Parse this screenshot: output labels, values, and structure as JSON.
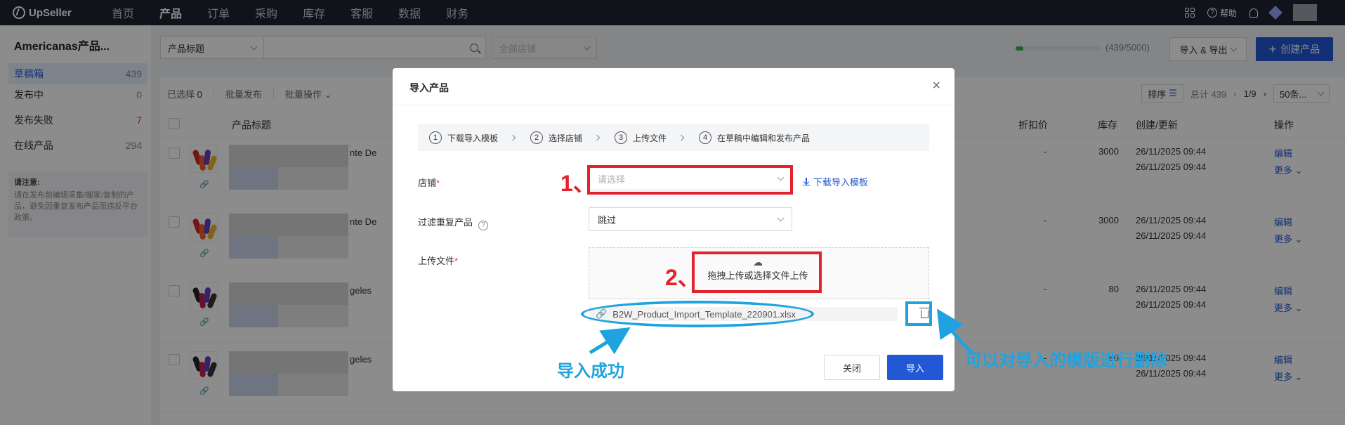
{
  "topnav": {
    "logo": "UpSeller",
    "items": [
      "首页",
      "产品",
      "订单",
      "采购",
      "库存",
      "客服",
      "数据",
      "财务"
    ],
    "active_index": 1,
    "help": "帮助"
  },
  "sidebar": {
    "store_title": "Americanas产品...",
    "items": [
      {
        "label": "草稿箱",
        "count": "439"
      },
      {
        "label": "发布中",
        "count": "0"
      },
      {
        "label": "发布失败",
        "count": "7"
      },
      {
        "label": "在线产品",
        "count": "294"
      }
    ],
    "notice_title": "请注意:",
    "notice_text": "请在发布前编辑采集/搬家/复制的产品，避免因重复发布产品而违反平台政策。"
  },
  "filter": {
    "field": "产品标题",
    "store_placeholder": "全部店铺"
  },
  "quota": {
    "text": "(439/5000)",
    "fraction": 0.088
  },
  "actions": {
    "import_export": "导入 & 导出",
    "create": "创建产品"
  },
  "toolbar": {
    "selected_label": "已选择",
    "selected_count": "0",
    "batch_publish": "批量发布",
    "batch_ops": "批量操作",
    "sort": "排序",
    "total": "总计 439",
    "page": "1/9",
    "per_page": "50条..."
  },
  "table": {
    "headers": {
      "title": "产品标题",
      "discount": "折扣价",
      "stock": "库存",
      "created": "创建/更新",
      "actions": "操作"
    },
    "rows": [
      {
        "title_suffix": "nte De",
        "discount": "-",
        "stock": "3000",
        "created": "26/11/2025 09:44",
        "updated": "26/11/2025 09:44",
        "edit": "编辑",
        "more": "更多"
      },
      {
        "title_suffix": "nte De",
        "discount": "-",
        "stock": "3000",
        "created": "26/11/2025 09:44",
        "updated": "26/11/2025 09:44",
        "edit": "编辑",
        "more": "更多"
      },
      {
        "title_suffix": "geles",
        "discount": "-",
        "stock": "80",
        "created": "26/11/2025 09:44",
        "updated": "26/11/2025 09:44",
        "edit": "编辑",
        "more": "更多"
      },
      {
        "title_suffix": "geles",
        "discount": "-",
        "stock": "80",
        "created": "26/11/2025 09:44",
        "updated": "26/11/2025 09:44",
        "edit": "编辑",
        "more": "更多"
      }
    ]
  },
  "modal": {
    "title": "导入产品",
    "steps": [
      {
        "num": "1",
        "label": "下载导入模板"
      },
      {
        "num": "2",
        "label": "选择店铺"
      },
      {
        "num": "3",
        "label": "上传文件"
      },
      {
        "num": "4",
        "label": "在草稿中编辑和发布产品"
      }
    ],
    "store_label": "店铺",
    "store_placeholder": "请选择",
    "download_template": "下载导入模板",
    "dedupe_label": "过滤重复产品",
    "dedupe_value": "跳过",
    "upload_label": "上传文件",
    "upload_hint": "拖拽上传或选择文件上传",
    "file_name": "B2W_Product_Import_Template_220901.xlsx",
    "close_btn": "关闭",
    "import_btn": "导入"
  },
  "annotations": {
    "step1": "1、",
    "step2": "2、",
    "success": "导入成功",
    "delete_hint": "可以对导入的模版进行删除",
    "red_color": "#e3222b",
    "blue_color": "#1fa3e0"
  }
}
